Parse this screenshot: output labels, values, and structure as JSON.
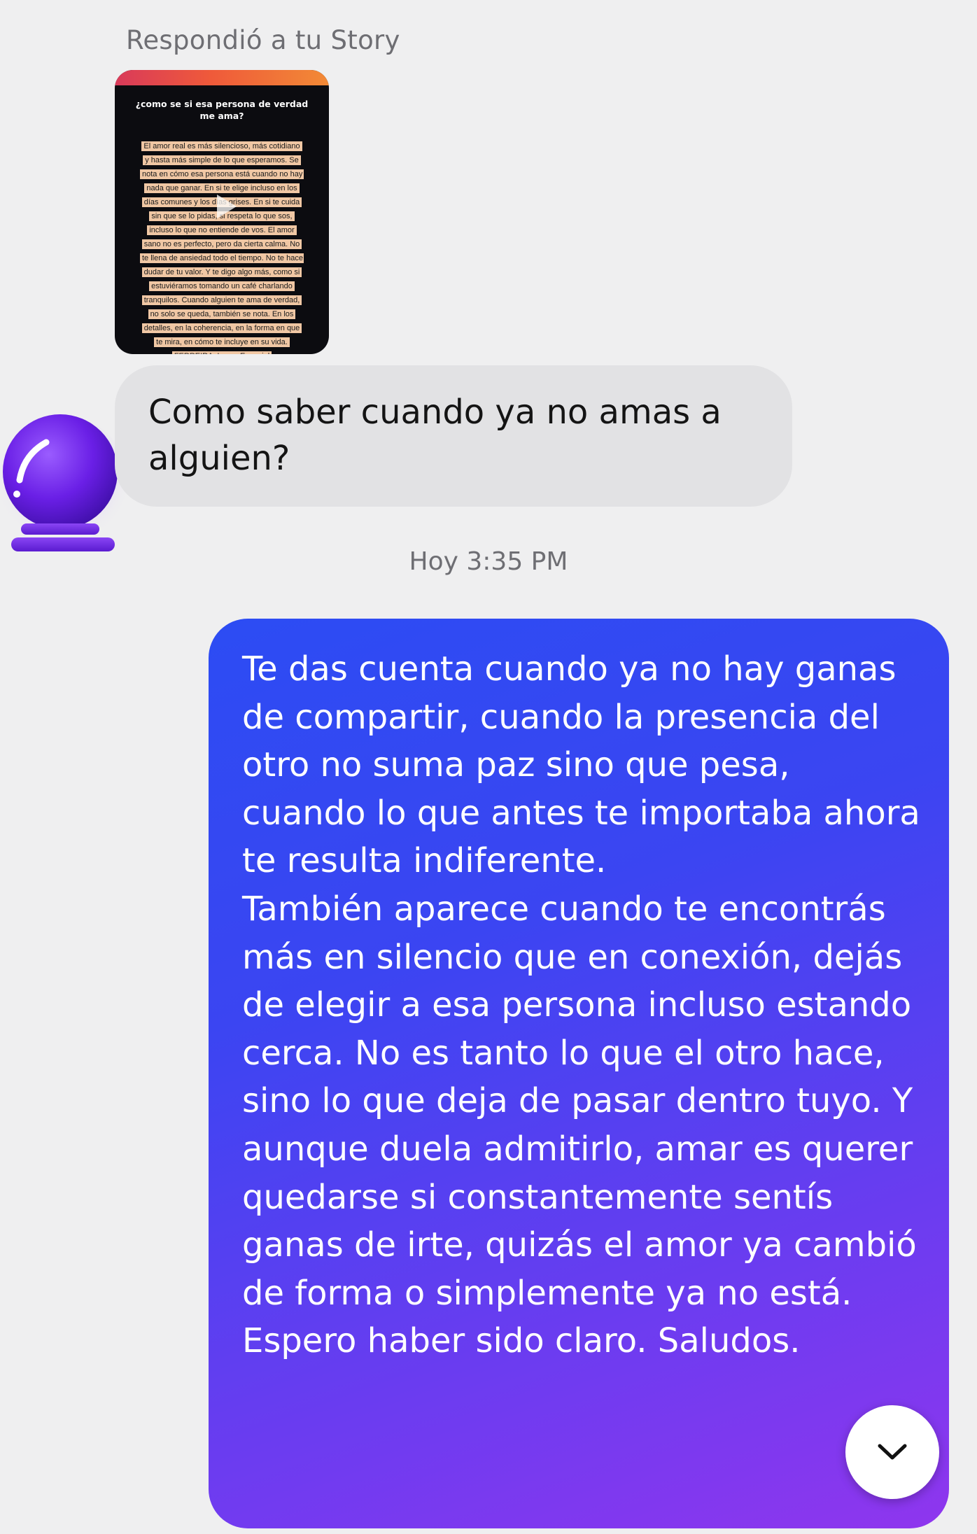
{
  "story_reply": {
    "label": "Respondió a tu Story",
    "story_title": "¿como se si esa persona de verdad me ama?",
    "story_text": "El amor real es más silencioso, más cotidiano y hasta más simple de lo que esperamos. Se nota en cómo esa persona está cuando no hay nada que ganar. En si te elige incluso en los días comunes y los días grises. En si te cuida sin que se lo pidas, si respeta lo que sos, incluso lo que no entiende de vos. El amor sano no es perfecto, pero da cierta calma. No te llena de ansiedad todo el tiempo. No te hace dudar de tu valor. Y te digo algo más, como si estuviéramos tomando un café charlando tranquilos. Cuando alguien te ama de verdad, no solo se queda, también se nota. En los detalles, en la coherencia, en la forma en que te mira, en cómo te incluye en su vida. FERREIRA, Lucas Ezequiel @el_profe_de_literatura"
  },
  "messages": {
    "question": "Como saber cuando ya no amas a alguien?",
    "timestamp": "Hoy 3:35 PM",
    "answer": "Te das cuenta cuando ya no hay ganas de compartir, cuando la presencia del otro no suma paz sino que pesa, cuando lo que antes te importaba ahora te resulta indiferente.\nTambién aparece cuando te encontrás más en silencio que en conexión, dejás de elegir a esa persona incluso estando cerca. No es tanto lo que el otro hace, sino lo que deja de pasar dentro tuyo. Y aunque duela admitirlo, amar es querer quedarse si constantemente sentís ganas de irte, quizás el amor ya cambió de forma o simplemente ya no está. Espero haber sido claro. Saludos."
  },
  "icons": {
    "avatar": "crystal-ball-icon",
    "play": "play-icon",
    "scroll_down": "chevron-down-icon"
  },
  "colors": {
    "background": "#efeff0",
    "received_bubble": "#e2e2e4",
    "sent_bubble_start": "#2c4cf3",
    "sent_bubble_end": "#8f36ee",
    "avatar_purple": "#7b2ff0"
  }
}
